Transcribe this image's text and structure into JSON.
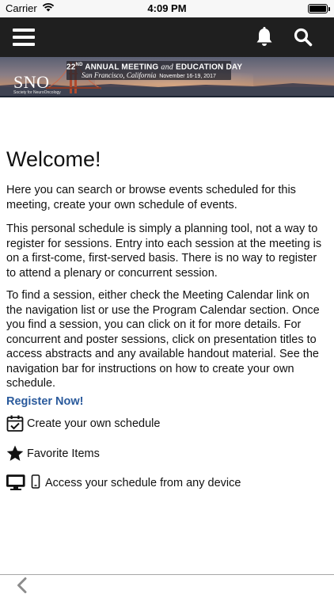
{
  "status_bar": {
    "carrier": "Carrier",
    "time": "4:09 PM",
    "icons": [
      "wifi-icon",
      "battery-icon"
    ]
  },
  "nav_bar": {
    "icons": [
      "menu-icon",
      "bell-icon",
      "search-icon"
    ],
    "background": "#1f1f1f"
  },
  "banner": {
    "logo": "SNO",
    "logo_subtitle": "Society for NeuroOncology",
    "edition": "22",
    "edition_suffix": "ND",
    "meeting_title_1": "ANNUAL MEETING",
    "meeting_and": "and",
    "meeting_title_2": "EDUCATION DAY",
    "location": "San Francisco, California",
    "dates": "November 16-19, 2017"
  },
  "main": {
    "title": "Welcome!",
    "paragraphs": [
      "Here you can search or browse events scheduled for this meeting, create your own schedule of events.",
      "This personal schedule is simply a planning tool, not a way to register for sessions. Entry into each session at the meeting is on a first-come, first-served basis. There is no way to register to attend a plenary or concurrent session.",
      "To find a session, either check the Meeting Calendar link on the navigation list or use the Program Calendar section. Once you find a session, you can click on it for more details. For concurrent and poster sessions, click on presentation titles to access abstracts and any available handout material. See the navigation bar for instructions on how to create your own schedule."
    ],
    "register_link": "Register Now!",
    "link_color": "#2a5a9c",
    "features": [
      {
        "icon": "calendar-check-icon",
        "label": "Create your own schedule"
      },
      {
        "icon": "star-icon",
        "label": "Favorite Items"
      },
      {
        "icon": "devices-icon",
        "label": "Access your schedule from any device"
      }
    ]
  },
  "bottom_bar": {
    "icons": [
      "back-chevron-icon"
    ]
  }
}
